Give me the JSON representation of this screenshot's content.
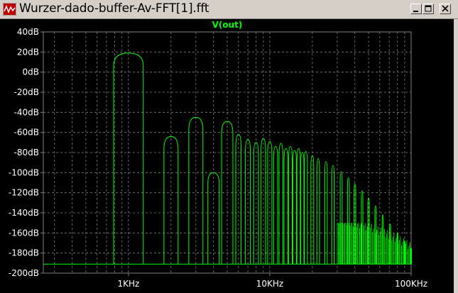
{
  "window": {
    "title": "Wurzer-dado-buffer-Av-FFT[1].fft"
  },
  "chart_data": {
    "type": "line",
    "title": "V(out)",
    "xscale": "log",
    "xlim": [
      250,
      100000
    ],
    "ylim": [
      -200,
      40
    ],
    "x_ticks": [
      "1KHz",
      "10KHz",
      "100KHz"
    ],
    "y_ticks": [
      "40dB",
      "20dB",
      "0dB",
      "-20dB",
      "-40dB",
      "-60dB",
      "-80dB",
      "-100dB",
      "-120dB",
      "-140dB",
      "-160dB",
      "-180dB",
      "-200dB"
    ],
    "grid": true,
    "colors": {
      "trace": "#00ff00",
      "grid": "#808080",
      "axis_text": "#ffffff",
      "background": "#000000"
    },
    "series": [
      {
        "name": "V(out)",
        "noise_floor_db": -191,
        "peaks": [
          {
            "freq": 1000,
            "db": 19
          },
          {
            "freq": 2000,
            "db": -64
          },
          {
            "freq": 3000,
            "db": -45
          },
          {
            "freq": 4000,
            "db": -100
          },
          {
            "freq": 5000,
            "db": -49
          },
          {
            "freq": 6000,
            "db": -62
          },
          {
            "freq": 7000,
            "db": -67
          },
          {
            "freq": 8000,
            "db": -70
          },
          {
            "freq": 9000,
            "db": -66
          },
          {
            "freq": 10000,
            "db": -69
          },
          {
            "freq": 11000,
            "db": -74
          },
          {
            "freq": 12000,
            "db": -71
          },
          {
            "freq": 13000,
            "db": -76
          },
          {
            "freq": 14000,
            "db": -74
          },
          {
            "freq": 15000,
            "db": -78
          },
          {
            "freq": 16000,
            "db": -76
          },
          {
            "freq": 17000,
            "db": -80
          },
          {
            "freq": 18000,
            "db": -79
          },
          {
            "freq": 20000,
            "db": -83
          },
          {
            "freq": 22000,
            "db": -86
          },
          {
            "freq": 25000,
            "db": -89
          },
          {
            "freq": 28000,
            "db": -93
          },
          {
            "freq": 32000,
            "db": -99
          },
          {
            "freq": 36000,
            "db": -105
          },
          {
            "freq": 40000,
            "db": -111
          },
          {
            "freq": 45000,
            "db": -118
          },
          {
            "freq": 50000,
            "db": -125
          },
          {
            "freq": 56000,
            "db": -133
          },
          {
            "freq": 63000,
            "db": -142
          },
          {
            "freq": 71000,
            "db": -151
          },
          {
            "freq": 80000,
            "db": -160
          },
          {
            "freq": 90000,
            "db": -168
          },
          {
            "freq": 100000,
            "db": -175
          }
        ]
      }
    ]
  }
}
